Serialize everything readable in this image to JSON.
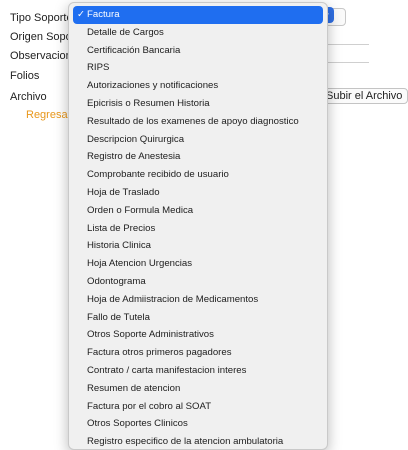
{
  "form": {
    "labels": [
      "Tipo Soporte",
      "Origen Soporte",
      "Observacion",
      "Folios",
      "Archivo"
    ],
    "back_link": "Regresar",
    "upload_button": "Subir el Archivo"
  },
  "dropdown": {
    "selected_index": 0,
    "options": [
      "Factura",
      "Detalle de Cargos",
      "Certificación Bancaria",
      "RIPS",
      "Autorizaciones y notificaciones",
      "Epicrisis o Resumen Historia",
      "Resultado de los examenes de apoyo diagnostico",
      "Descripcion Quirurgica",
      "Registro de Anestesia",
      "Comprobante recibido de usuario",
      "Hoja de Traslado",
      "Orden o Formula Medica",
      "Lista de Precios",
      "Historia Clinica",
      "Hoja Atencion Urgencias",
      "Odontograma",
      "Hoja de Admiistracion de Medicamentos",
      "Fallo de Tutela",
      "Otros Soporte Administrativos",
      "Factura otros primeros pagadores",
      "Contrato / carta manifestacion interes",
      "Resumen de atencion",
      "Factura por el cobro al SOAT",
      "Otros Soportes Clinicos",
      "Registro especifico de la atencion ambulatoria"
    ]
  }
}
